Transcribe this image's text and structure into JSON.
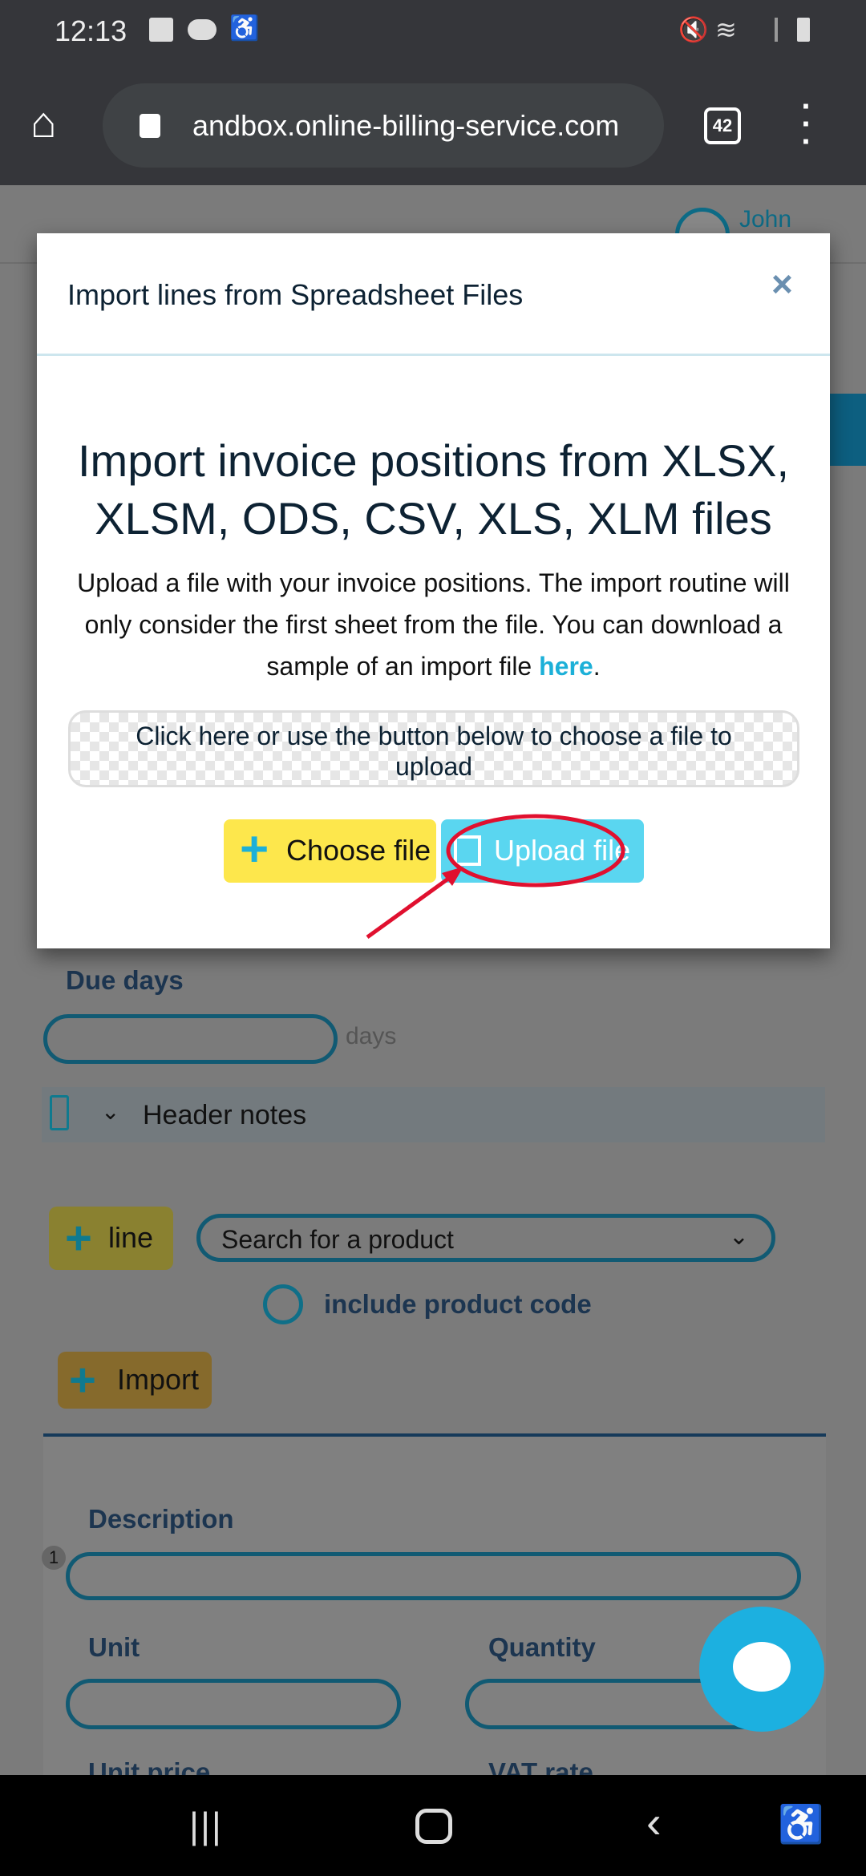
{
  "status_bar": {
    "time": "12:13",
    "icons": [
      "image-icon",
      "cloud-sync-icon",
      "accessibility-icon",
      "mute-icon",
      "wifi-icon",
      "signal-icon",
      "battery-icon"
    ]
  },
  "browser": {
    "url": "andbox.online-billing-service.com",
    "tab_count": "42"
  },
  "background_page": {
    "user_name": "John",
    "due_days_label": "Due days",
    "days_unit": "days",
    "header_notes": "Header notes",
    "add_line_label": "line",
    "product_search_placeholder": "Search for a product",
    "include_product_code": "include product code",
    "import_label": "Import",
    "line_number": "1",
    "description_label": "Description",
    "unit_label": "Unit",
    "quantity_label": "Quantity",
    "unit_price_label": "Unit price",
    "vat_rate_label": "VAT rate"
  },
  "modal": {
    "title": "Import lines from Spreadsheet Files",
    "close": "×",
    "heading": "Import invoice positions from XLSX, XLSM, ODS, CSV, XLS, XLM files",
    "description": "Upload a file with your invoice positions. The import routine will only consider the first sheet from the file. You can download a sample of an import file ",
    "link": "here",
    "description_end": ".",
    "dropzone": "Click here or use the button below to choose a file to upload",
    "choose_file": "Choose file",
    "upload_file": "Upload file"
  },
  "colors": {
    "accent": "#1cb0d8",
    "annotation": "#e0102f",
    "yellow": "#fde74c",
    "cyan": "#5ad6f0"
  }
}
